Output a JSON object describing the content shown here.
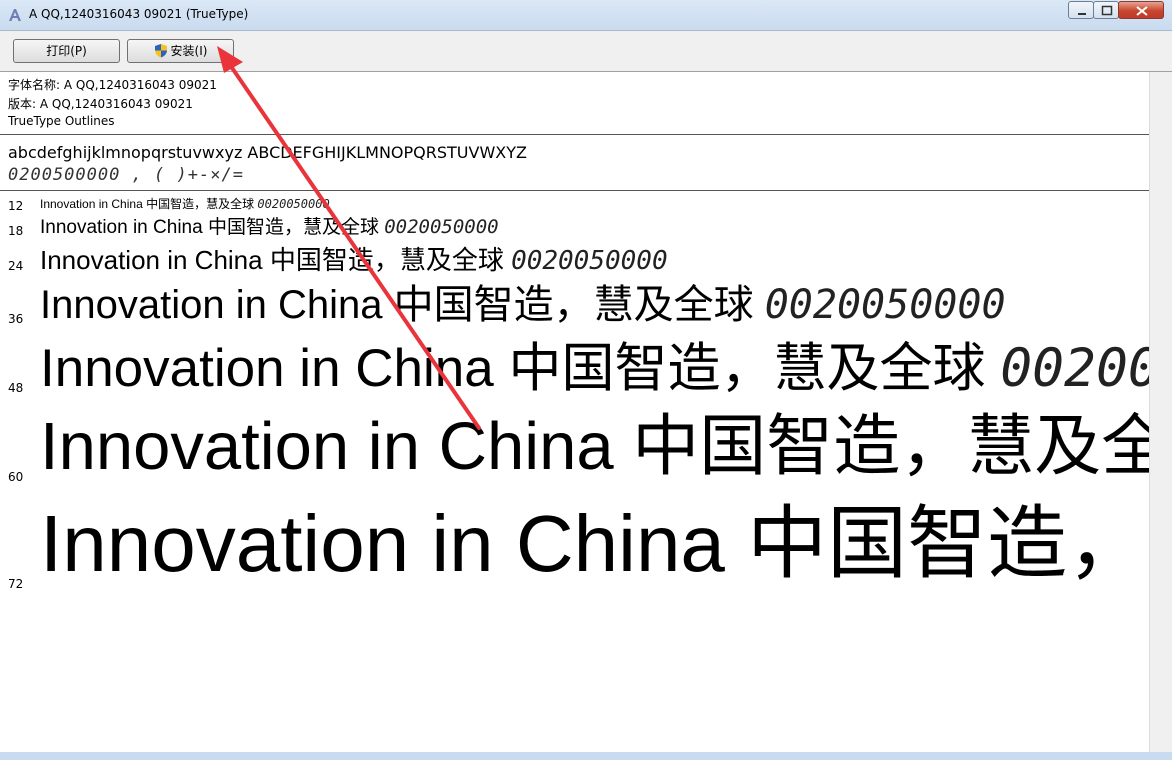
{
  "window": {
    "title": "A QQ,1240316043  09021 (TrueType)",
    "icon": "font-viewer-icon"
  },
  "toolbar": {
    "print_label": "打印(P)",
    "install_label": "安装(I)",
    "install_icon": "uac-shield-icon"
  },
  "info": {
    "font_name": "字体名称: A QQ,1240316043  09021",
    "version": "版本: A QQ,1240316043  09021",
    "outline": "TrueType Outlines"
  },
  "charset": {
    "alphabet": "abcdefghijklmnopqrstuvwxyz ABCDEFGHIJKLMNOPQRSTUVWXYZ",
    "digits": "0200500000 ,    (  )+-×/="
  },
  "samples": {
    "text": "Innovation in China 中国智造，慧及全球",
    "number": "0020050000",
    "rows": [
      {
        "size": "12"
      },
      {
        "size": "18"
      },
      {
        "size": "24"
      },
      {
        "size": "36"
      },
      {
        "size": "48"
      },
      {
        "size": "60"
      },
      {
        "size": "72"
      }
    ]
  },
  "colors": {
    "annotation_arrow": "#e8343a",
    "titlebar": "#c9dbef",
    "close_button": "#c7462d"
  }
}
